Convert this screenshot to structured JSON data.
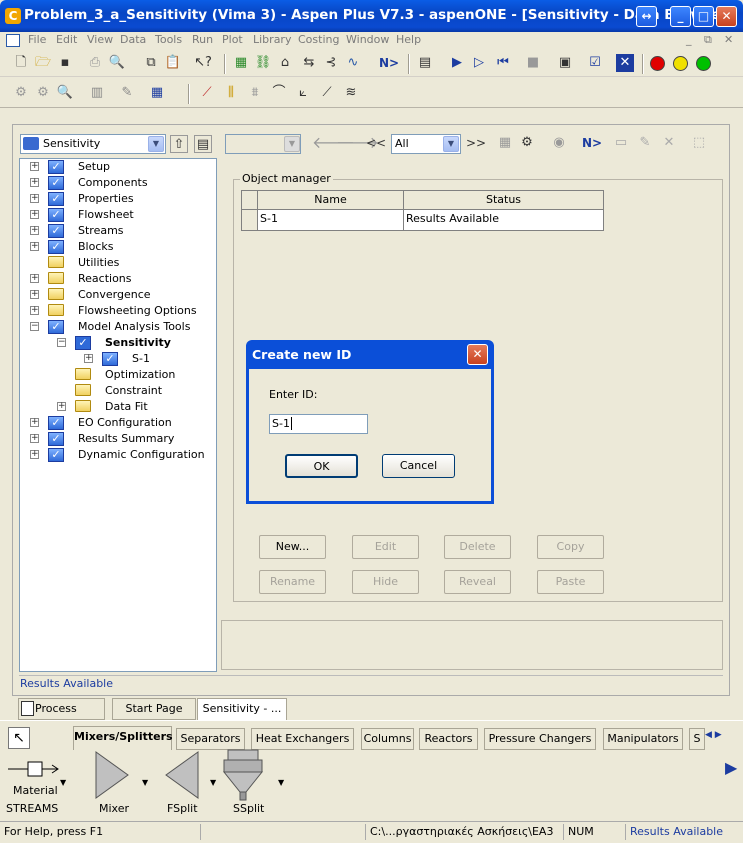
{
  "window": {
    "title": "Problem_3_a_Sensitivity (Vima 3) - Aspen Plus V7.3 - aspenONE - [Sensitivity - Data Browser]",
    "restore_icon": "resize-icon",
    "minimize_glyph": "_",
    "maximize_glyph": "□",
    "close_glyph": "✕"
  },
  "menu": [
    "File",
    "Edit",
    "View",
    "Data",
    "Tools",
    "Run",
    "Plot",
    "Library",
    "Costing",
    "Window",
    "Help"
  ],
  "menu_right": {
    "minimize": "_",
    "restore": "⧉",
    "close": "✕"
  },
  "toolbar": {
    "next_label": "N>",
    "status_colors": [
      "#e00000",
      "#f0e000",
      "#00c000"
    ]
  },
  "browser": {
    "form_select": "Sensitivity",
    "nav_back": "<<",
    "nav_forward": ">>",
    "filter_value": "All",
    "next_label": "N>"
  },
  "tree": {
    "items": [
      {
        "label": "Setup",
        "icon": "check",
        "level": 0,
        "expander": "+"
      },
      {
        "label": "Components",
        "icon": "check",
        "level": 0,
        "expander": "+"
      },
      {
        "label": "Properties",
        "icon": "check",
        "level": 0,
        "expander": "+"
      },
      {
        "label": "Flowsheet",
        "icon": "check",
        "level": 0,
        "expander": "+"
      },
      {
        "label": "Streams",
        "icon": "check",
        "level": 0,
        "expander": "+"
      },
      {
        "label": "Blocks",
        "icon": "check",
        "level": 0,
        "expander": "+"
      },
      {
        "label": "Utilities",
        "icon": "folder",
        "level": 0,
        "expander": ""
      },
      {
        "label": "Reactions",
        "icon": "folder",
        "level": 0,
        "expander": "+"
      },
      {
        "label": "Convergence",
        "icon": "folder",
        "level": 0,
        "expander": "+"
      },
      {
        "label": "Flowsheeting Options",
        "icon": "folder",
        "level": 0,
        "expander": "+"
      },
      {
        "label": "Model Analysis Tools",
        "icon": "check",
        "level": 0,
        "expander": "−"
      },
      {
        "label": "Sensitivity",
        "icon": "check-open",
        "level": 1,
        "expander": "−",
        "bold": true
      },
      {
        "label": "S-1",
        "icon": "check",
        "level": 2,
        "expander": "+"
      },
      {
        "label": "Optimization",
        "icon": "folder",
        "level": 1,
        "expander": ""
      },
      {
        "label": "Constraint",
        "icon": "folder",
        "level": 1,
        "expander": ""
      },
      {
        "label": "Data Fit",
        "icon": "folder",
        "level": 1,
        "expander": "+"
      },
      {
        "label": "EO Configuration",
        "icon": "check",
        "level": 0,
        "expander": "+"
      },
      {
        "label": "Results Summary",
        "icon": "check",
        "level": 0,
        "expander": "+"
      },
      {
        "label": "Dynamic Configuration",
        "icon": "check",
        "level": 0,
        "expander": "+"
      }
    ]
  },
  "object_manager": {
    "title": "Object manager",
    "columns": [
      "Name",
      "Status"
    ],
    "rows": [
      {
        "name": "S-1",
        "status": "Results Available"
      }
    ],
    "buttons": {
      "new": "New...",
      "edit": "Edit",
      "delete": "Delete",
      "copy": "Copy",
      "rename": "Rename",
      "hide": "Hide",
      "reveal": "Reveal",
      "paste": "Paste"
    }
  },
  "dialog": {
    "title": "Create new ID",
    "prompt": "Enter ID:",
    "value": "S-1",
    "ok": "OK",
    "cancel": "Cancel",
    "close_glyph": "✕"
  },
  "status_line": "Results Available",
  "window_tabs": [
    {
      "label": "Process Flo...",
      "active": false
    },
    {
      "label": "Start Page",
      "active": false
    },
    {
      "label": "Sensitivity - ...",
      "active": true
    }
  ],
  "palette": {
    "tabs": [
      "Mixers/Splitters",
      "Separators",
      "Heat Exchangers",
      "Columns",
      "Reactors",
      "Pressure Changers",
      "Manipulators",
      "S"
    ],
    "active_tab": "Mixers/Splitters",
    "stream_label": "Material",
    "streams_caption": "STREAMS",
    "models": [
      "Mixer",
      "FSplit",
      "SSplit"
    ]
  },
  "statusbar": {
    "help": "For Help, press F1",
    "path": "C:\\...ργαστηριακές Ασκήσεις\\EA3",
    "num": "NUM",
    "results": "Results Available"
  }
}
